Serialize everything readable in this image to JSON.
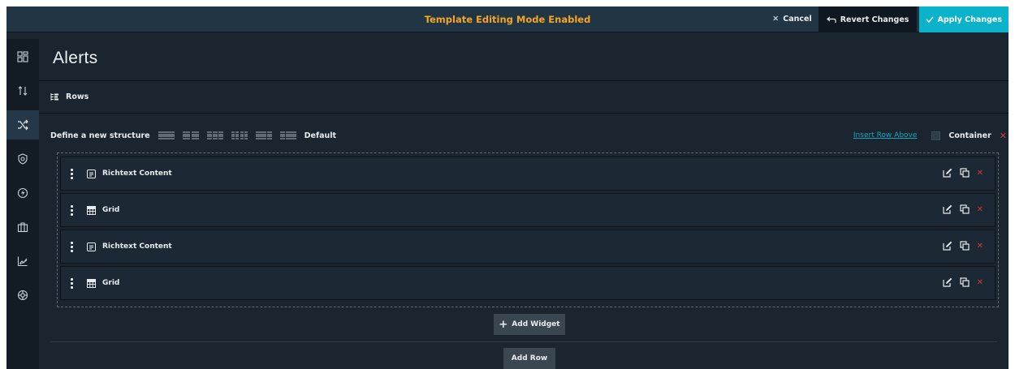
{
  "topbar": {
    "mode_title": "Template Editing Mode Enabled",
    "cancel_label": "Cancel",
    "revert_label": "Revert Changes",
    "apply_label": "Apply Changes"
  },
  "rail": {
    "items": [
      {
        "icon": "dashboard-grid-icon"
      },
      {
        "icon": "sort-icon"
      },
      {
        "icon": "shuffle-icon",
        "active": true
      },
      {
        "icon": "shield-icon"
      },
      {
        "icon": "lightning-icon"
      },
      {
        "icon": "briefcase-icon"
      },
      {
        "icon": "chart-icon"
      },
      {
        "icon": "globe-icon"
      }
    ]
  },
  "page": {
    "title": "Alerts",
    "rows_label": "Rows"
  },
  "structure": {
    "define_label": "Define a new structure",
    "layouts": [
      "layout-1-col",
      "layout-2-col",
      "layout-3-col",
      "layout-4-col",
      "layout-2-1-col",
      "layout-1-2-col"
    ],
    "default_label": "Default",
    "insert_row_above": "Insert Row Above",
    "container_label": "Container"
  },
  "widgets": [
    {
      "label": "Richtext Content",
      "icon": "richtext-icon"
    },
    {
      "label": "Grid",
      "icon": "grid-icon"
    },
    {
      "label": "Richtext Content",
      "icon": "richtext-icon"
    },
    {
      "label": "Grid",
      "icon": "grid-icon"
    }
  ],
  "actions": {
    "add_widget": "Add Widget",
    "add_row": "Add Row"
  },
  "colors": {
    "accent": "#0ab3c9",
    "warning": "#f5a623",
    "danger": "#d13c3c",
    "background": "#1a2530"
  }
}
